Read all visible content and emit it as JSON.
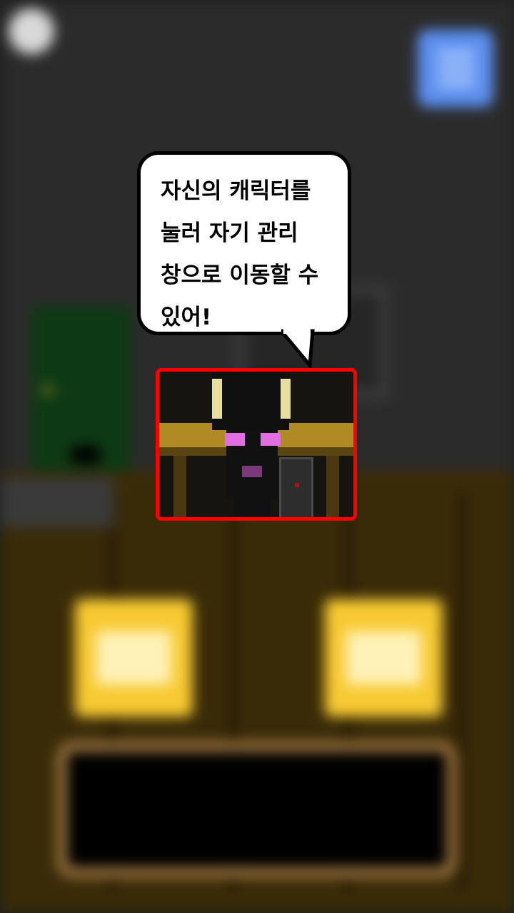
{
  "header": {
    "title_blurred": "",
    "right_blurred": ""
  },
  "subheader": {
    "text_blurred": ""
  },
  "tutorial": {
    "bubble_text": "자신의 캐릭터를\n눌러 자기 관리\n창으로 이동할 수\n있어!"
  },
  "colors": {
    "highlight_border": "#ff0000",
    "menu_button": "#5b8ff0",
    "action_button": "#f7c932",
    "panel_border": "#a07842"
  },
  "icons": {
    "menu": "hamburger-icon",
    "profile": "avatar-icon",
    "mail": "envelope-icon"
  }
}
